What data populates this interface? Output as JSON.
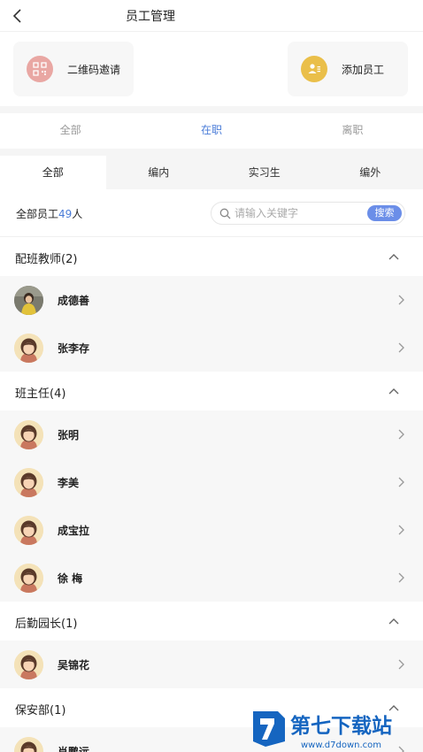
{
  "header": {
    "title": "员工管理"
  },
  "actions": {
    "qr_invite": "二维码邀请",
    "add_employee": "添加员工"
  },
  "status_tabs": [
    {
      "label": "全部",
      "active": false
    },
    {
      "label": "在职",
      "active": true
    },
    {
      "label": "离职",
      "active": false
    }
  ],
  "type_tabs": [
    {
      "label": "全部",
      "active": true
    },
    {
      "label": "编内",
      "active": false
    },
    {
      "label": "实习生",
      "active": false
    },
    {
      "label": "编外",
      "active": false
    }
  ],
  "summary": {
    "prefix": "全部员工",
    "count": "49",
    "suffix": "人"
  },
  "search": {
    "placeholder": "请输入关键字",
    "button": "搜索"
  },
  "groups": [
    {
      "name": "配班教师(2)",
      "members": [
        {
          "name": "成德善",
          "avatar": "photo"
        },
        {
          "name": "张李存",
          "avatar": "default"
        }
      ]
    },
    {
      "name": "班主任(4)",
      "members": [
        {
          "name": "张明",
          "avatar": "default"
        },
        {
          "name": "李美",
          "avatar": "default"
        },
        {
          "name": "成宝拉",
          "avatar": "default"
        },
        {
          "name": "徐 梅",
          "avatar": "default"
        }
      ]
    },
    {
      "name": "后勤园长(1)",
      "members": [
        {
          "name": "吴锦花",
          "avatar": "default"
        }
      ]
    },
    {
      "name": "保安部(1)",
      "members": [
        {
          "name": "肖鹏远",
          "avatar": "default"
        }
      ]
    }
  ],
  "watermark": {
    "brand": "第七下载站",
    "url": "www.d7down.com"
  },
  "colors": {
    "accent": "#4a7cd8",
    "search_button": "#6b8ee8",
    "qr_icon_bg": "#e9a7a3",
    "add_icon_bg": "#eabf4a"
  },
  "icons": {
    "back": "chevron-left-icon",
    "qr": "qr-code-icon",
    "add": "add-user-icon",
    "search": "search-icon",
    "collapse": "chevron-up-icon",
    "row": "chevron-right-icon"
  }
}
